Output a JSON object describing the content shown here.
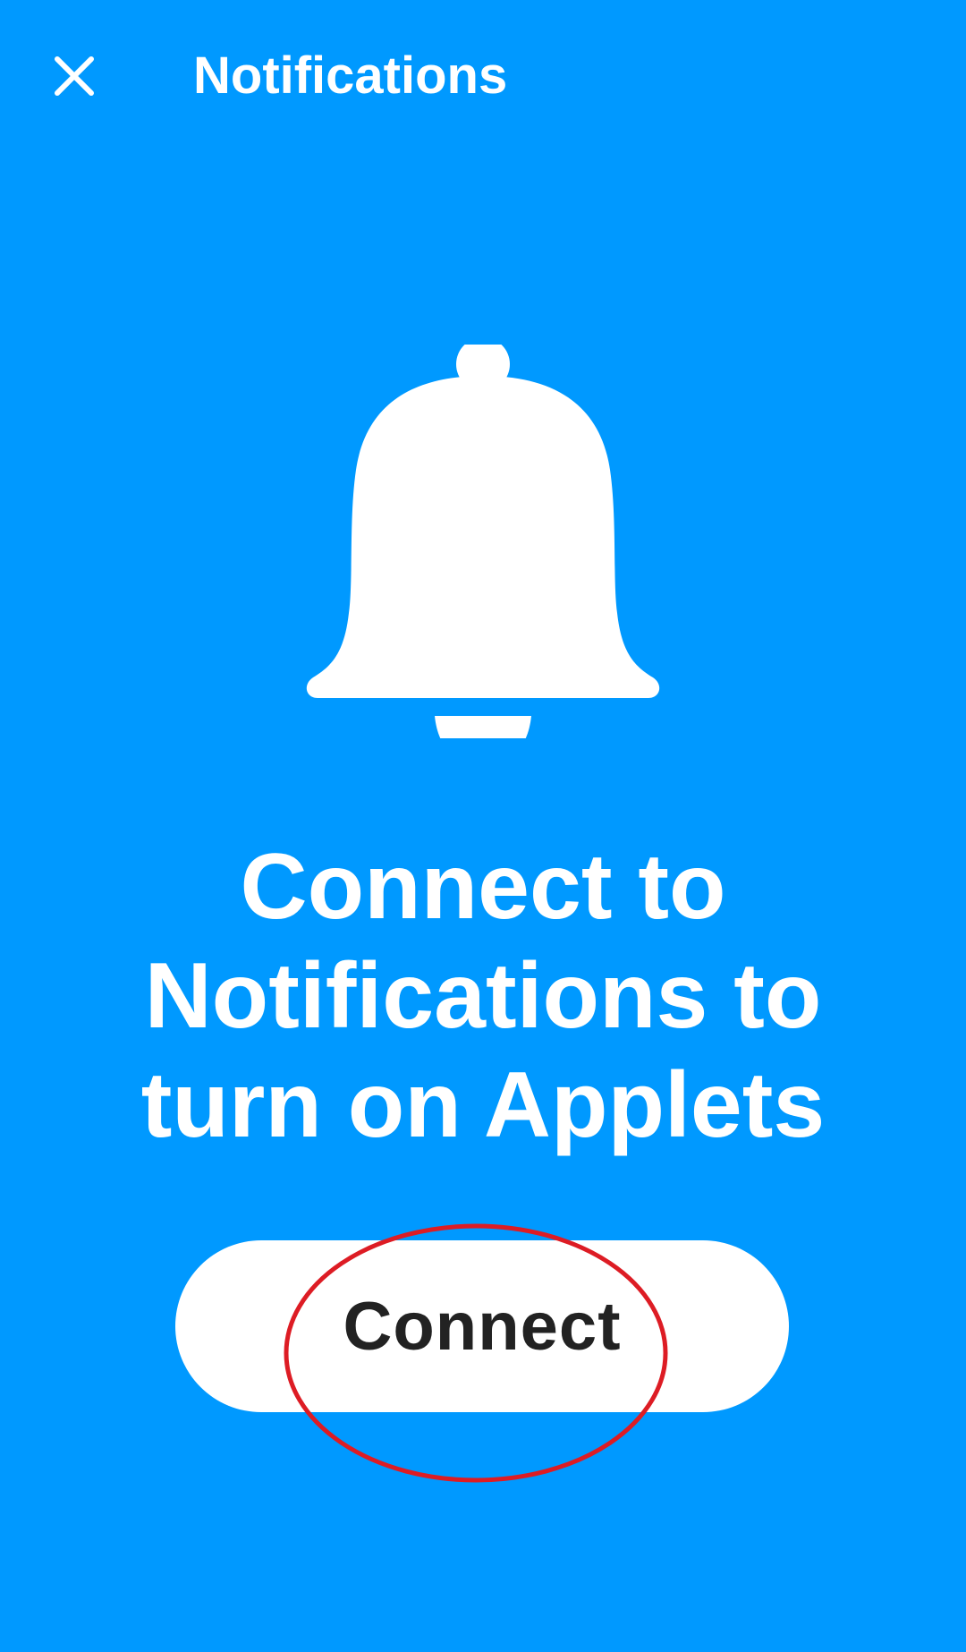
{
  "theme": {
    "background_color": "#0099ff",
    "foreground_color": "#ffffff",
    "button_background": "#ffffff",
    "button_text_color": "#222222",
    "annotation_color": "#dd1c24"
  },
  "header": {
    "close_icon": "close-icon",
    "title": "Notifications"
  },
  "hero": {
    "icon": "bell-icon"
  },
  "main": {
    "headline": "Connect to Notifications to turn on Applets",
    "connect_button_label": "Connect"
  },
  "annotation": {
    "shape": "ellipse",
    "target": "connect-button"
  }
}
